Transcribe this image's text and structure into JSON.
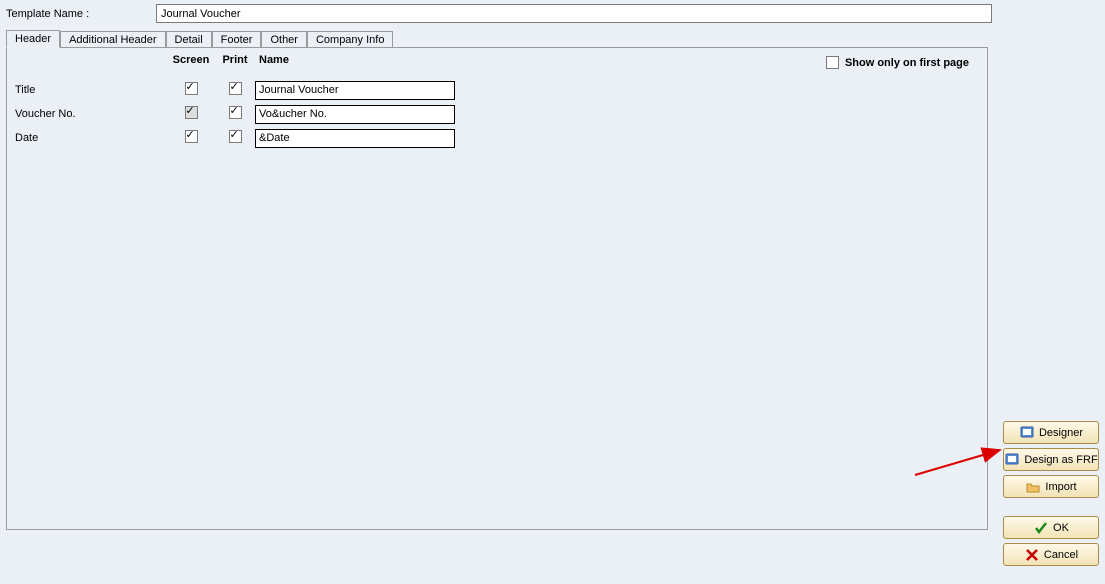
{
  "top": {
    "label": "Template Name :",
    "value": "Journal Voucher"
  },
  "tabs": [
    "Header",
    "Additional Header",
    "Detail",
    "Footer",
    "Other",
    "Company Info"
  ],
  "activeTab": 0,
  "columns": {
    "screen": "Screen",
    "print": "Print",
    "name": "Name"
  },
  "showOnly": {
    "label": "Show only on first page",
    "checked": false
  },
  "rows": [
    {
      "label": "Title",
      "screen": true,
      "screenDisabled": false,
      "print": true,
      "name": "Journal Voucher"
    },
    {
      "label": "Voucher No.",
      "screen": true,
      "screenDisabled": true,
      "print": true,
      "name": "Vo&ucher No."
    },
    {
      "label": "Date",
      "screen": true,
      "screenDisabled": false,
      "print": true,
      "name": "&Date"
    }
  ],
  "buttons": {
    "designer": "Designer",
    "designFrf": "Design as FRF",
    "import": "Import",
    "ok": "OK",
    "cancel": "Cancel"
  }
}
